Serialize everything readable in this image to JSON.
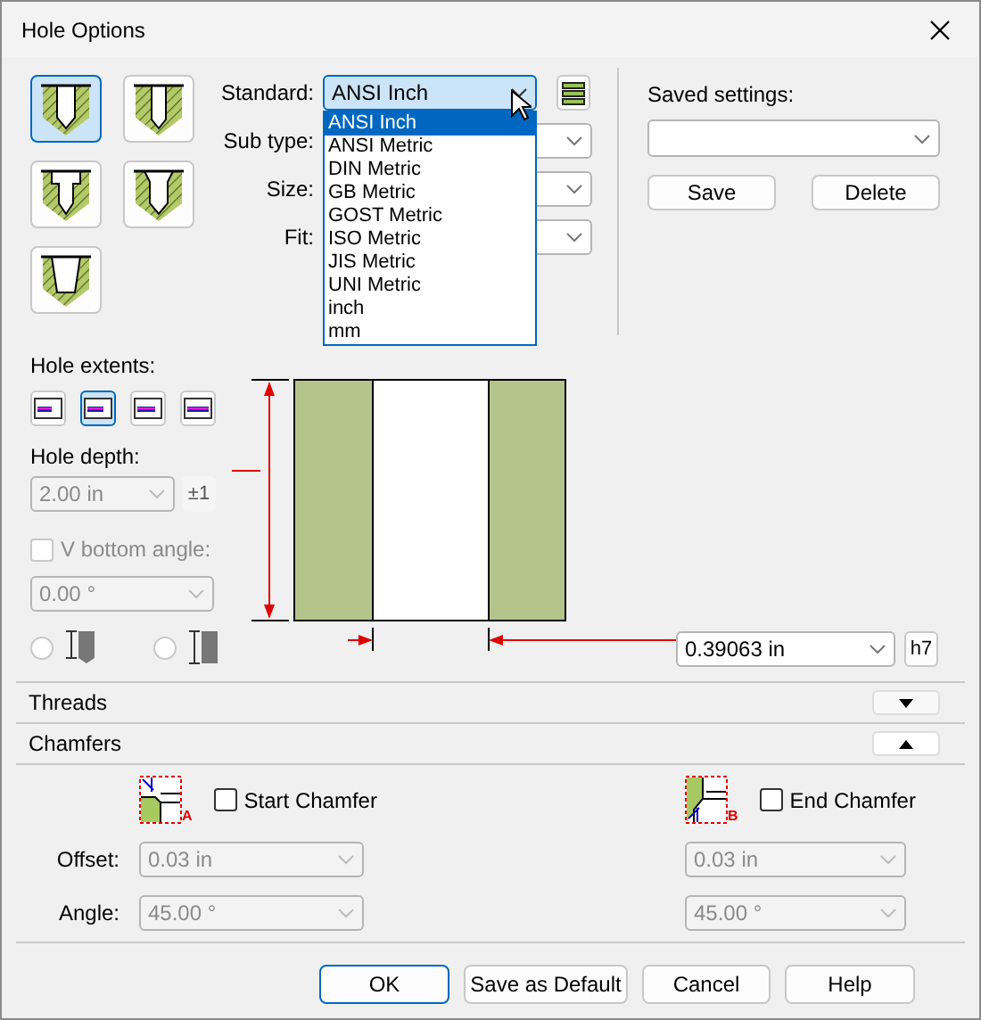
{
  "window": {
    "title": "Hole Options"
  },
  "hole_types": [
    {
      "selected": true
    },
    {
      "selected": false
    },
    {
      "selected": false
    },
    {
      "selected": false
    },
    {
      "selected": false
    }
  ],
  "standard": {
    "label": "Standard:",
    "value": "ANSI Inch"
  },
  "standard_options": [
    {
      "label": "ANSI Inch",
      "selected": true
    },
    {
      "label": "ANSI Metric",
      "selected": false
    },
    {
      "label": "DIN Metric",
      "selected": false
    },
    {
      "label": "GB Metric",
      "selected": false
    },
    {
      "label": "GOST Metric",
      "selected": false
    },
    {
      "label": "ISO Metric",
      "selected": false
    },
    {
      "label": "JIS Metric",
      "selected": false
    },
    {
      "label": "UNI Metric",
      "selected": false
    },
    {
      "label": "inch",
      "selected": false
    },
    {
      "label": "mm",
      "selected": false
    }
  ],
  "fields": [
    {
      "label": "Sub type:"
    },
    {
      "label": "Size:"
    },
    {
      "label": "Fit:"
    }
  ],
  "saved_settings": {
    "label": "Saved settings:",
    "buttons": [
      "Save",
      "Delete"
    ]
  },
  "hole_extents": {
    "label": "Hole extents:",
    "options": [
      {
        "selected": false
      },
      {
        "selected": true
      },
      {
        "selected": false
      },
      {
        "selected": false
      }
    ]
  },
  "hole_depth": {
    "label": "Hole depth:",
    "value": "2.00 in",
    "disabled": true,
    "tolerance_button": "±1"
  },
  "v_bottom": {
    "label": "V bottom angle:",
    "checked": false,
    "disabled": true,
    "value": "0.00 °"
  },
  "bottom_types": [
    {
      "selected": false
    },
    {
      "selected": false
    }
  ],
  "diameter": {
    "value": "0.39063 in",
    "fit_button": "h7"
  },
  "sections": [
    {
      "title": "Threads",
      "expanded": false
    },
    {
      "title": "Chamfers",
      "expanded": true
    }
  ],
  "chamfers": {
    "row_labels": [
      "Offset:",
      "Angle:"
    ],
    "sides": [
      {
        "label": "Start Chamfer",
        "checked": false,
        "marker": "A",
        "offset": "0.03 in",
        "angle": "45.00 °",
        "disabled": true
      },
      {
        "label": "End Chamfer",
        "checked": false,
        "marker": "B",
        "offset": "0.03 in",
        "angle": "45.00 °",
        "disabled": true
      }
    ]
  },
  "buttons": [
    {
      "label": "OK",
      "default": true
    },
    {
      "label": "Save as Default",
      "default": false
    },
    {
      "label": "Cancel",
      "default": false
    },
    {
      "label": "Help",
      "default": false
    }
  ]
}
